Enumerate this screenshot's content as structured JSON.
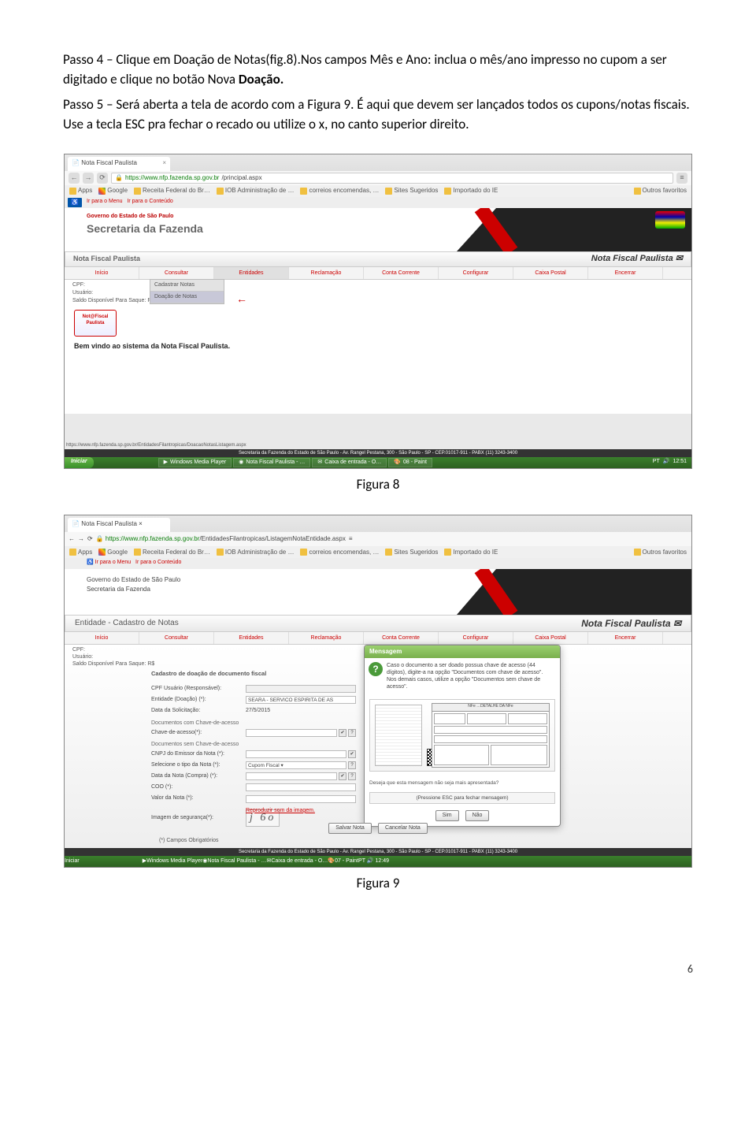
{
  "text": {
    "p1a": "Passo 4 – Clique em Doação de Notas(fig.8).Nos campos Mês e Ano: inclua o mês/ano impresso no cupom a ser digitado e clique no botão Nova ",
    "p1b": "Doação.",
    "p2": "Passo 5 – Será aberta a tela de acordo com a Figura 9. É aqui que devem ser lançados todos os cupons/notas fiscais. Use a tecla ESC pra fechar o recado ou utilize o x, no canto superior direito.",
    "cap1": "Figura 8",
    "cap2": "Figura 9",
    "pagenum": "6"
  },
  "s1": {
    "tab_title": "Nota Fiscal Paulista",
    "url_host": "https://www.nfp.fazenda.sp.gov.br",
    "url_path": "/principal.aspx",
    "bookmarks": [
      "Apps",
      "Google",
      "Receita Federal do Br…",
      "IOB Administração de …",
      "correios encomendas, …",
      "Sites Sugeridos",
      "Importado do IE"
    ],
    "bookmarks_right": "Outros favoritos",
    "skip1": "Ir para o Menu",
    "skip2": "Ir para o Conteúdo",
    "gov1": "Governo do Estado de São Paulo",
    "gov2": "Secretaria da Fazenda",
    "nfp_left": "Nota Fiscal Paulista",
    "nfp_right": "Nota Fiscal Paulista",
    "menu": [
      "Início",
      "Consultar",
      "Entidades",
      "Reclamação",
      "Conta Corrente",
      "Configurar",
      "Caixa Postal",
      "Encerrar"
    ],
    "sub_cpf": "CPF:",
    "sub_user": "Usuário:",
    "sub_saldo": "Saldo Disponível Para Saque: R$",
    "dropdown": [
      "Cadastrar Notas",
      "Doação de Notas"
    ],
    "logo_text": "Not@Fiscal Paulista",
    "welcome": "Bem vindo ao sistema da Nota Fiscal Paulista.",
    "status_url": "https://www.nfp.fazenda.sp.gov.br/EntidadesFilantropicas/DoacaoNotasListagem.aspx",
    "footer": "Secretaria da Fazenda do Estado de São Paulo - Av. Rangel Pestana, 300 - São Paulo - SP - CEP.01017-911 - PABX (11) 3243-3400",
    "tb_start": "Iniciar",
    "tb_items": [
      "Windows Media Player",
      "Nota Fiscal Paulista - …",
      "Caixa de entrada - O…",
      "08 - Paint"
    ],
    "tb_clock": "12:51",
    "tb_lang": "PT"
  },
  "s2": {
    "tab_title": "Nota Fiscal Paulista",
    "url_host": "https://www.nfp.fazenda.sp.gov.br",
    "url_path": "/EntidadesFilantropicas/ListagemNotaEntidade.aspx",
    "gov1": "Governo do Estado de São Paulo",
    "gov2": "Secretaria da Fazenda",
    "nfp_left": "Entidade - Cadastro de Notas",
    "nfp_right": "Nota Fiscal Paulista",
    "menu": [
      "Início",
      "Consultar",
      "Entidades",
      "Reclamação",
      "Conta Corrente",
      "Configurar",
      "Caixa Postal",
      "Encerrar"
    ],
    "user_cpf": "CPF:",
    "user_user": "Usuário:",
    "user_saldo": "Saldo Disponível Para Saque: R$",
    "form_title": "Cadastro de doação de documento fiscal",
    "labels": {
      "cpf": "CPF Usuário (Responsável):",
      "entidade": "Entidade (Doação) (*):",
      "data_sol": "Data da Solicitação:",
      "sec_com": "Documentos com Chave-de-acesso",
      "chave": "Chave-de-acesso(*):",
      "sec_sem": "Documentos sem Chave-de-acesso",
      "cnpj": "CNPJ do Emissor da Nota (*):",
      "tipo": "Selecione o tipo da Nota (*):",
      "data_comp": "Data da Nota (Compra) (*):",
      "coo": "COO (*):",
      "valor": "Valor da Nota (*):",
      "imgseg": "Imagem de segurança(*):",
      "oblig": "(*) Campos Obrigatórios"
    },
    "values": {
      "entidade": "SEARA - SERVICO ESPIRITA DE AS",
      "data_sol": "27/5/2015",
      "tipo": "Cupom Fiscal ▾"
    },
    "captcha": "j 6o",
    "repro_link": "Reproduzir som da imagem.",
    "btn_salvar": "Salvar Nota",
    "btn_cancelar": "Cancelar Nota",
    "modal": {
      "title": "Mensagem",
      "body1": "Caso o documento a ser doado possua chave de acesso (44 dígitos), digite-a na opção \"Documentos com chave de acesso\".",
      "body2": "Nos demais casos, utilize a opção \"Documentos sem chave de acesso\".",
      "receipt_head": "NFe  …DETALHE DA NFe",
      "foot": "Deseja que esta mensagem não seja mais apresentada?",
      "esc": "(Pressione ESC para fechar mensagem)",
      "btn_sim": "Sim",
      "btn_nao": "Não"
    },
    "footer": "Secretaria da Fazenda do Estado de São Paulo - Av. Rangel Pestana, 300 - São Paulo - SP - CEP.01017-911 - PABX (11) 3243-3400",
    "tb_start": "Iniciar",
    "tb_items": [
      "Windows Media Player",
      "Nota Fiscal Paulista - …",
      "Caixa de entrada - O…",
      "07 - Paint"
    ],
    "tb_clock": "12:49",
    "tb_lang": "PT"
  }
}
